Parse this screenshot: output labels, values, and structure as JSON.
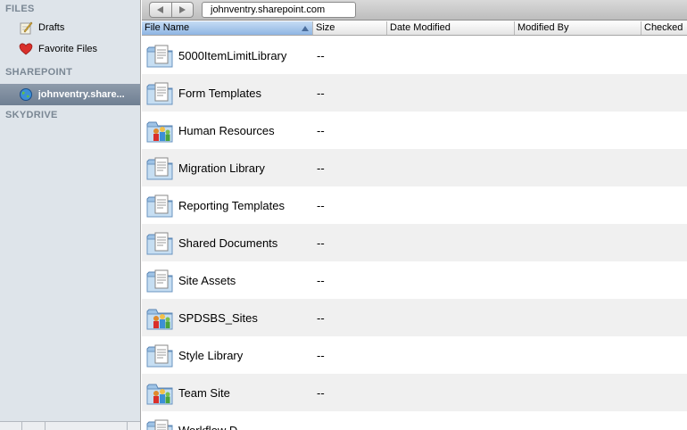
{
  "sidebar": {
    "files_header": "FILES",
    "drafts": "Drafts",
    "favorite_files": "Favorite Files",
    "sharepoint_header": "SHAREPOINT",
    "site": "johnventry.share...",
    "skydrive_header": "SKYDRIVE"
  },
  "toolbar": {
    "path": "johnventry.sharepoint.com"
  },
  "columns": {
    "file_name": "File Name",
    "size": "Size",
    "date_modified": "Date Modified",
    "modified_by": "Modified By",
    "checked": "Checked"
  },
  "rows": [
    {
      "name": "5000ItemLimitLibrary",
      "size": "--",
      "icon": "doc-folder-icon"
    },
    {
      "name": "Form Templates",
      "size": "--",
      "icon": "doc-folder-icon"
    },
    {
      "name": "Human Resources",
      "size": "--",
      "icon": "site-folder-icon"
    },
    {
      "name": "Migration Library",
      "size": "--",
      "icon": "doc-folder-icon"
    },
    {
      "name": "Reporting Templates",
      "size": "--",
      "icon": "doc-folder-icon"
    },
    {
      "name": "Shared Documents",
      "size": "--",
      "icon": "doc-folder-icon"
    },
    {
      "name": "Site Assets",
      "size": "--",
      "icon": "doc-folder-icon"
    },
    {
      "name": "SPDSBS_Sites",
      "size": "--",
      "icon": "site-folder-icon"
    },
    {
      "name": "Style Library",
      "size": "--",
      "icon": "doc-folder-icon"
    },
    {
      "name": "Team Site",
      "size": "--",
      "icon": "site-folder-icon"
    },
    {
      "name": "Workflow D...",
      "size": "",
      "icon": "doc-folder-icon"
    }
  ],
  "colors": {
    "sidebar_bg": "#dee4ea",
    "selected_bg": "#7d8ca0",
    "sort_header": "#a8c8ee"
  }
}
